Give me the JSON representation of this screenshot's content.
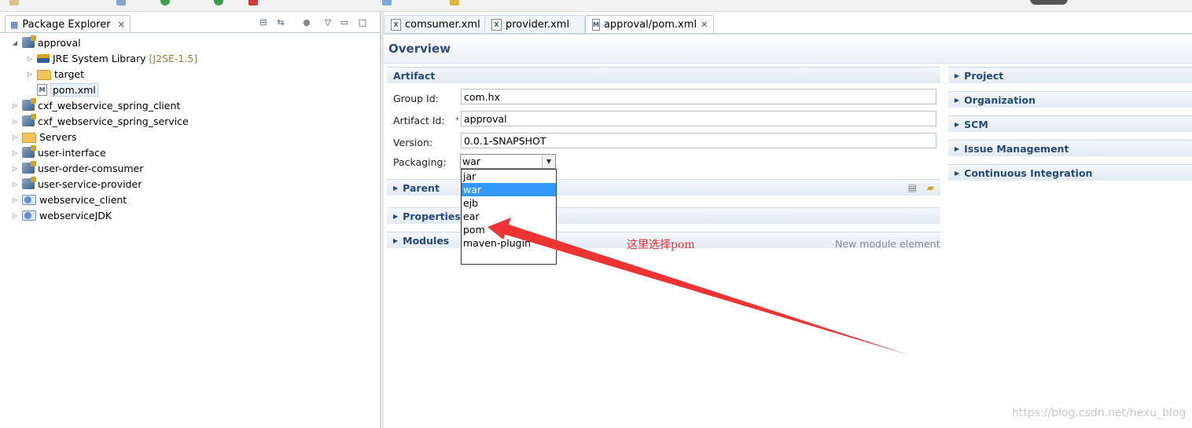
{
  "left_panel": {
    "tab_title": "Package Explorer",
    "tree": [
      {
        "label": "approval",
        "expanded": true,
        "icon": "project-icon"
      },
      {
        "label": "JRE System Library",
        "decoration": "[J2SE-1.5]",
        "icon": "library-icon"
      },
      {
        "label": "target",
        "icon": "folder-icon"
      },
      {
        "label": "pom.xml",
        "icon": "maven-file-icon"
      },
      {
        "label": "cxf_webservice_spring_client",
        "icon": "project-icon"
      },
      {
        "label": "cxf_webservice_spring_service",
        "icon": "project-icon"
      },
      {
        "label": "Servers",
        "icon": "folder-icon"
      },
      {
        "label": "user-interface",
        "icon": "project-icon"
      },
      {
        "label": "user-order-comsumer",
        "icon": "project-icon"
      },
      {
        "label": "user-service-provider",
        "icon": "project-icon"
      },
      {
        "label": "webservice_client",
        "icon": "webservice-project-icon"
      },
      {
        "label": "webserviceJDK",
        "icon": "webservice-project-icon"
      }
    ]
  },
  "editor": {
    "tabs": [
      {
        "label": "comsumer.xml",
        "icon": "xml-file-icon"
      },
      {
        "label": "provider.xml",
        "icon": "xml-file-icon"
      },
      {
        "label": "approval/pom.xml",
        "icon": "maven-file-icon",
        "active": true
      }
    ],
    "page_title": "Overview",
    "artifact": {
      "header": "Artifact",
      "group_id_label": "Group Id:",
      "group_id": "com.hx",
      "artifact_id_label": "Artifact Id:",
      "required_marker": "*",
      "artifact_id": "approval",
      "version_label": "Version:",
      "version": "0.0.1-SNAPSHOT",
      "packaging_label": "Packaging:",
      "packaging": "war",
      "packaging_options": [
        "jar",
        "war",
        "ejb",
        "ear",
        "pom",
        "maven-plugin"
      ]
    },
    "sections": {
      "parent": "Parent",
      "properties": "Properties",
      "modules": "Modules",
      "new_module": "New module element"
    },
    "right_sections": [
      "Project",
      "Organization",
      "SCM",
      "Issue Management",
      "Continuous Integration"
    ]
  },
  "annotation": {
    "text": "这里选择pom",
    "color": "#e53333"
  },
  "watermark": "https://blog.csdn.net/hexu_blog",
  "colors": {
    "section_title": "#254a7c",
    "selection": "#3399ff"
  }
}
